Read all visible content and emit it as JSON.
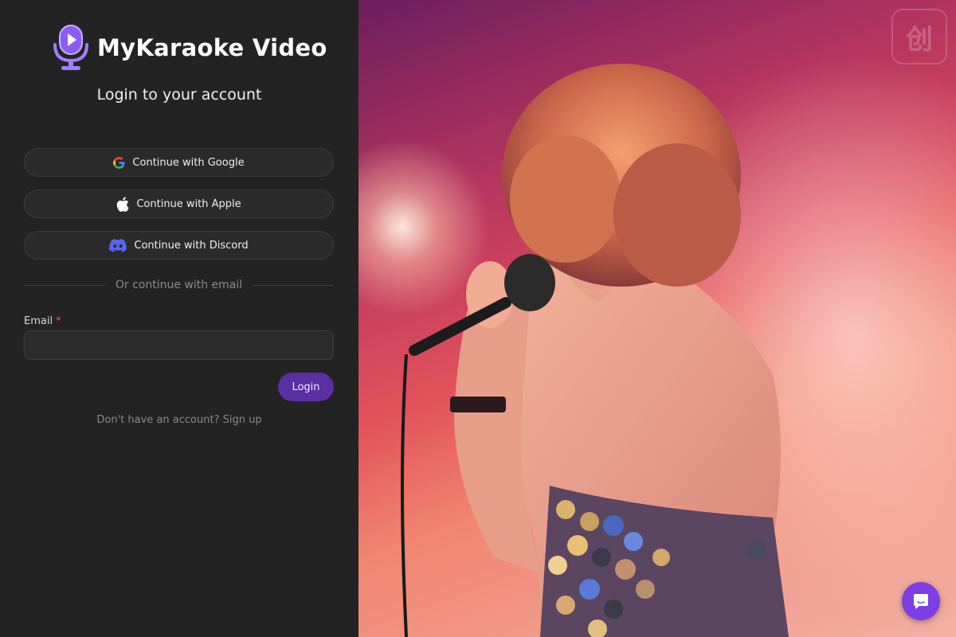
{
  "brand": {
    "name": "MyKaraoke Video",
    "logo_icon": "microphone-play-icon",
    "accent_color": "#8b5cf6"
  },
  "login": {
    "subtitle": "Login to your account",
    "oauth": {
      "google_label": "Continue with Google",
      "apple_label": "Continue with Apple",
      "discord_label": "Continue with Discord"
    },
    "divider_text": "Or continue with email",
    "email_label": "Email",
    "email_required_marker": "*",
    "email_value": "",
    "login_button_label": "Login",
    "signup_prompt": "Don't have an account?",
    "signup_link": "Sign up",
    "login_button_color": "#5b2ea3"
  },
  "photo": {
    "description_icon": "karaoke-singer-photo"
  },
  "watermark": {
    "text": "创"
  },
  "chat": {
    "icon": "chat-bubble-icon",
    "color": "#7b3fe4"
  }
}
